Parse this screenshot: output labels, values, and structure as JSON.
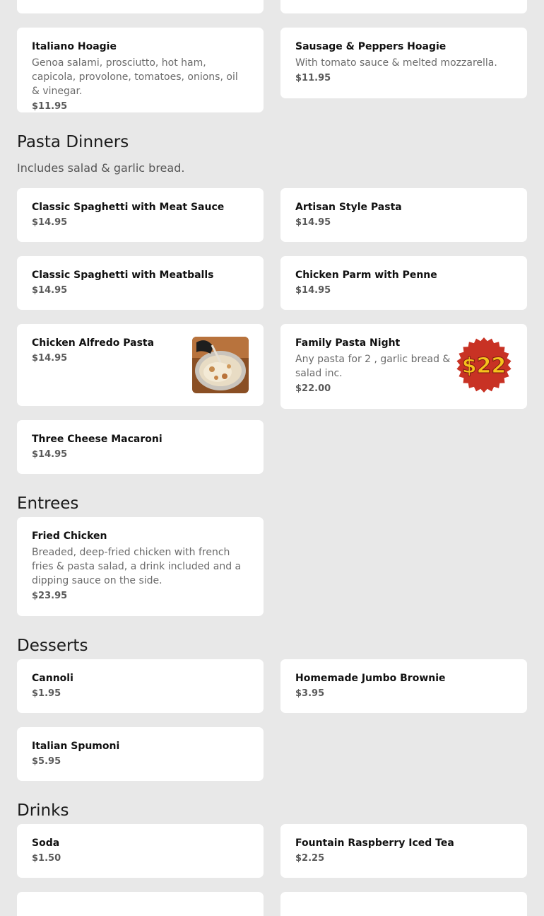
{
  "sections": {
    "pasta": {
      "title": "Pasta Dinners",
      "subtitle": "Includes salad & garlic bread."
    },
    "entrees": {
      "title": "Entrees"
    },
    "desserts": {
      "title": "Desserts"
    },
    "drinks": {
      "title": "Drinks"
    }
  },
  "hoagies": [
    {
      "name": "Italiano Hoagie",
      "description": "Genoa salami, prosciutto, hot ham, capicola, provolone, tomatoes, onions, oil & vinegar.",
      "price": "$11.95"
    },
    {
      "name": "Sausage & Peppers Hoagie",
      "description": "With tomato sauce & melted mozzarella.",
      "price": "$11.95"
    }
  ],
  "pasta_items": [
    {
      "name": "Classic Spaghetti with Meat Sauce",
      "price": "$14.95"
    },
    {
      "name": "Artisan Style Pasta",
      "price": "$14.95"
    },
    {
      "name": "Classic Spaghetti with Meatballs",
      "price": "$14.95"
    },
    {
      "name": "Chicken Parm with Penne",
      "price": "$14.95"
    },
    {
      "name": "Chicken Alfredo Pasta",
      "price": "$14.95",
      "image_icon": "pasta-photo"
    },
    {
      "name": "Family Pasta Night",
      "description": "Any pasta for 2 , garlic bread & salad inc.",
      "price": "$22.00",
      "badge_text": "$22",
      "badge_color": "#c83224",
      "badge_text_color": "#f6c21c"
    },
    {
      "name": "Three Cheese Macaroni",
      "price": "$14.95"
    }
  ],
  "entrees_items": [
    {
      "name": "Fried Chicken",
      "description": "Breaded, deep-fried chicken with french fries & pasta salad, a drink included and a dipping sauce on the side.",
      "price": "$23.95"
    }
  ],
  "desserts_items": [
    {
      "name": "Cannoli",
      "price": "$1.95"
    },
    {
      "name": "Homemade Jumbo Brownie",
      "price": "$3.95"
    },
    {
      "name": "Italian Spumoni",
      "price": "$5.95"
    }
  ],
  "drinks_items": [
    {
      "name": "Soda",
      "price": "$1.50"
    },
    {
      "name": "Fountain Raspberry Iced Tea",
      "price": "$2.25"
    }
  ]
}
